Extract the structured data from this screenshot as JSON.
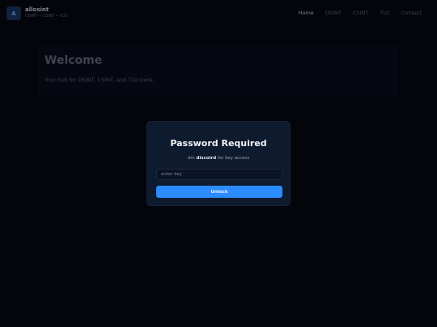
{
  "header": {
    "logo_letter": "A",
    "brand_name": "allosint",
    "brand_tagline": "OSINT • CSINT • TLO",
    "nav": [
      {
        "label": "Home",
        "active": true
      },
      {
        "label": "OSINT",
        "active": false
      },
      {
        "label": "CSINT",
        "active": false
      },
      {
        "label": "TLO",
        "active": false
      },
      {
        "label": "Contact",
        "active": false
      }
    ]
  },
  "welcome": {
    "title": "Welcome",
    "subtitle": "Your hub for OSINT, CSINT, and TLO tools."
  },
  "modal": {
    "title": "Password Required",
    "hint_prefix": "dm",
    "hint_bold": "discoird",
    "hint_suffix": "for key access",
    "input_placeholder": "enter key",
    "input_value": "",
    "button_label": "Unlock"
  },
  "colors": {
    "background": "#04070d",
    "modal_bg": "#0e1a2e",
    "accent": "#2a8cff"
  }
}
